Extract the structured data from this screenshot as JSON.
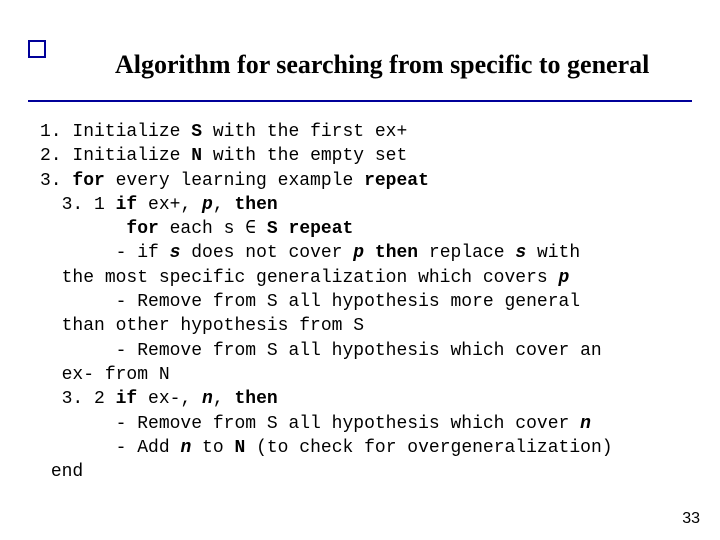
{
  "title": "Algorithm for searching from specific to general",
  "body": {
    "l1a": "1. Initialize ",
    "l1S": "S",
    "l1b": " with the first ex+",
    "l2a": "2. Initialize ",
    "l2N": "N",
    "l2b": " with the empty set",
    "l3a": "3. ",
    "l3for": "for",
    "l3b": " every learning example ",
    "l3rep": "repeat",
    "l31a": "  3. 1 ",
    "l31if": "if",
    "l31b": " ex+, ",
    "l31p": "p",
    "l31c": ", ",
    "l31then": "then",
    "l4a": "        ",
    "l4for": "for",
    "l4b": " each s ",
    "l4in": "∈",
    "l4c": " ",
    "l4S": "S",
    "l4d": " ",
    "l4rep": "repeat",
    "l5a": "       - if ",
    "l5s": "s",
    "l5b": " does not cover ",
    "l5p": "p",
    "l5c": " ",
    "l5then": "then",
    "l5d": " replace ",
    "l5s2": "s",
    "l5e": " with",
    "l6a": "  the most specific generalization which covers ",
    "l6p": "p",
    "l7": "       - Remove from S all hypothesis more general",
    "l8": "  than other hypothesis from S",
    "l9": "       - Remove from S all hypothesis which cover an",
    "l10": "  ex- from N",
    "l32a": "  3. 2 ",
    "l32if": "if",
    "l32b": " ex-, ",
    "l32n": "n",
    "l32c": ", ",
    "l32then": "then",
    "l11a": "       - Remove from S all hypothesis which cover ",
    "l11n": "n",
    "l12a": "       - Add ",
    "l12n": "n",
    "l12b": " to ",
    "l12N": "N",
    "l12c": " (to check for overgeneralization)",
    "lend": " end"
  },
  "page_number": "33"
}
